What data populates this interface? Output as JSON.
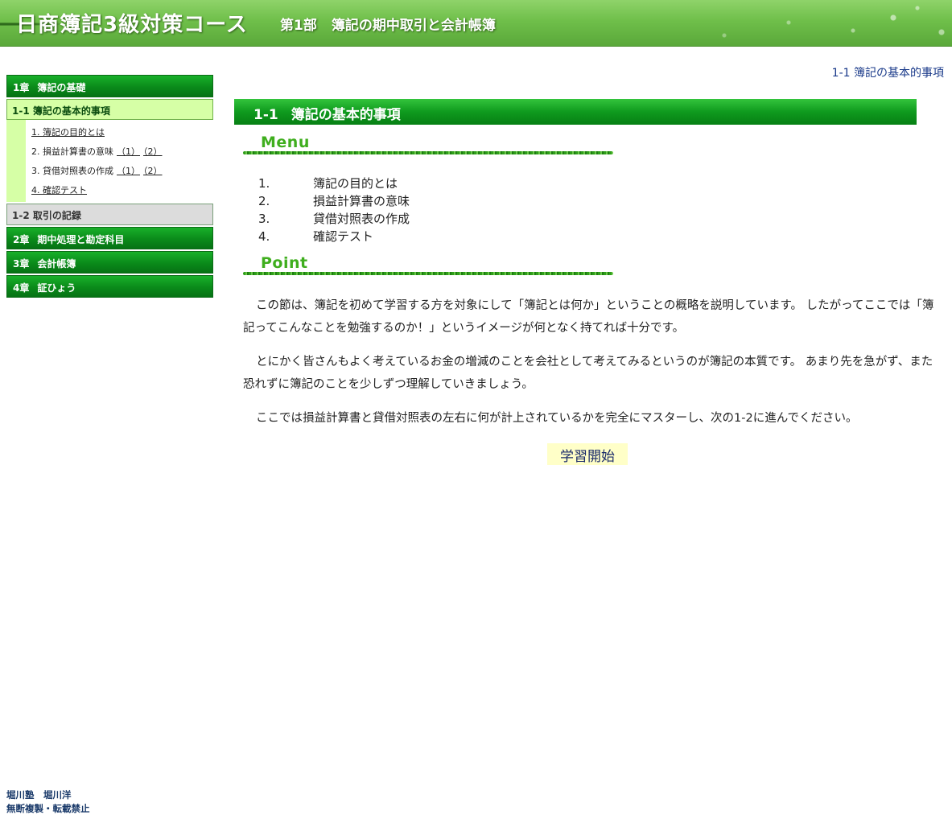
{
  "header": {
    "title": "日商簿記3級対策コース",
    "part": "第1部",
    "part_title": "簿記の期中取引と会計帳簿"
  },
  "sidebar": {
    "chapters": [
      {
        "num": "1章",
        "label": "簿記の基礎"
      },
      {
        "num": "2章",
        "label": "期中処理と勘定科目"
      },
      {
        "num": "3章",
        "label": "会計帳簿"
      },
      {
        "num": "4章",
        "label": "証ひょう"
      }
    ],
    "active_section": "1-1 簿記の基本的事項",
    "sub_items": [
      {
        "label": "1. 簿記の目的とは"
      },
      {
        "label": "2. 損益計算書の意味",
        "parts": [
          "（1）",
          "（2）"
        ]
      },
      {
        "label": "3. 貸借対照表の作成",
        "parts": [
          "（1）",
          "（2）"
        ]
      },
      {
        "label": "4. 確認テスト"
      }
    ],
    "other_section": "1-2 取引の記録"
  },
  "breadcrumb": "1-1 簿記の基本的事項",
  "main": {
    "heading_num": "1-1",
    "heading_title": "簿記の基本的事項",
    "menu_label": "Menu",
    "point_label": "Point",
    "menu_items": [
      {
        "num": "1.",
        "label": "簿記の目的とは"
      },
      {
        "num": "2.",
        "label": "損益計算書の意味"
      },
      {
        "num": "3.",
        "label": "貸借対照表の作成"
      },
      {
        "num": "4.",
        "label": "確認テスト"
      }
    ],
    "paragraphs": [
      "この節は、簿記を初めて学習する方を対象にして「簿記とは何か」ということの概略を説明しています。 したがってここでは「簿記ってこんなことを勉強するのか！」というイメージが何となく持てれば十分です。",
      "とにかく皆さんもよく考えているお金の増減のことを会社として考えてみるというのが簿記の本質です。 あまり先を急がず、また恐れずに簿記のことを少しずつ理解していきましょう。",
      "ここでは損益計算書と貸借対照表の左右に何が計上されているかを完全にマスターし、次の1-2に進んでください。"
    ],
    "start_button": "学習開始"
  },
  "footer": {
    "line1": "堀川塾　堀川洋",
    "line2": "無断複製・転載禁止"
  },
  "colors": {
    "banner_green": "#6fbf4a",
    "chapter_green": "#0a8a1a",
    "active_section_bg": "#d6ffa6",
    "start_button_bg": "#ffffc8",
    "breadcrumb_text": "#1a3a8a"
  }
}
